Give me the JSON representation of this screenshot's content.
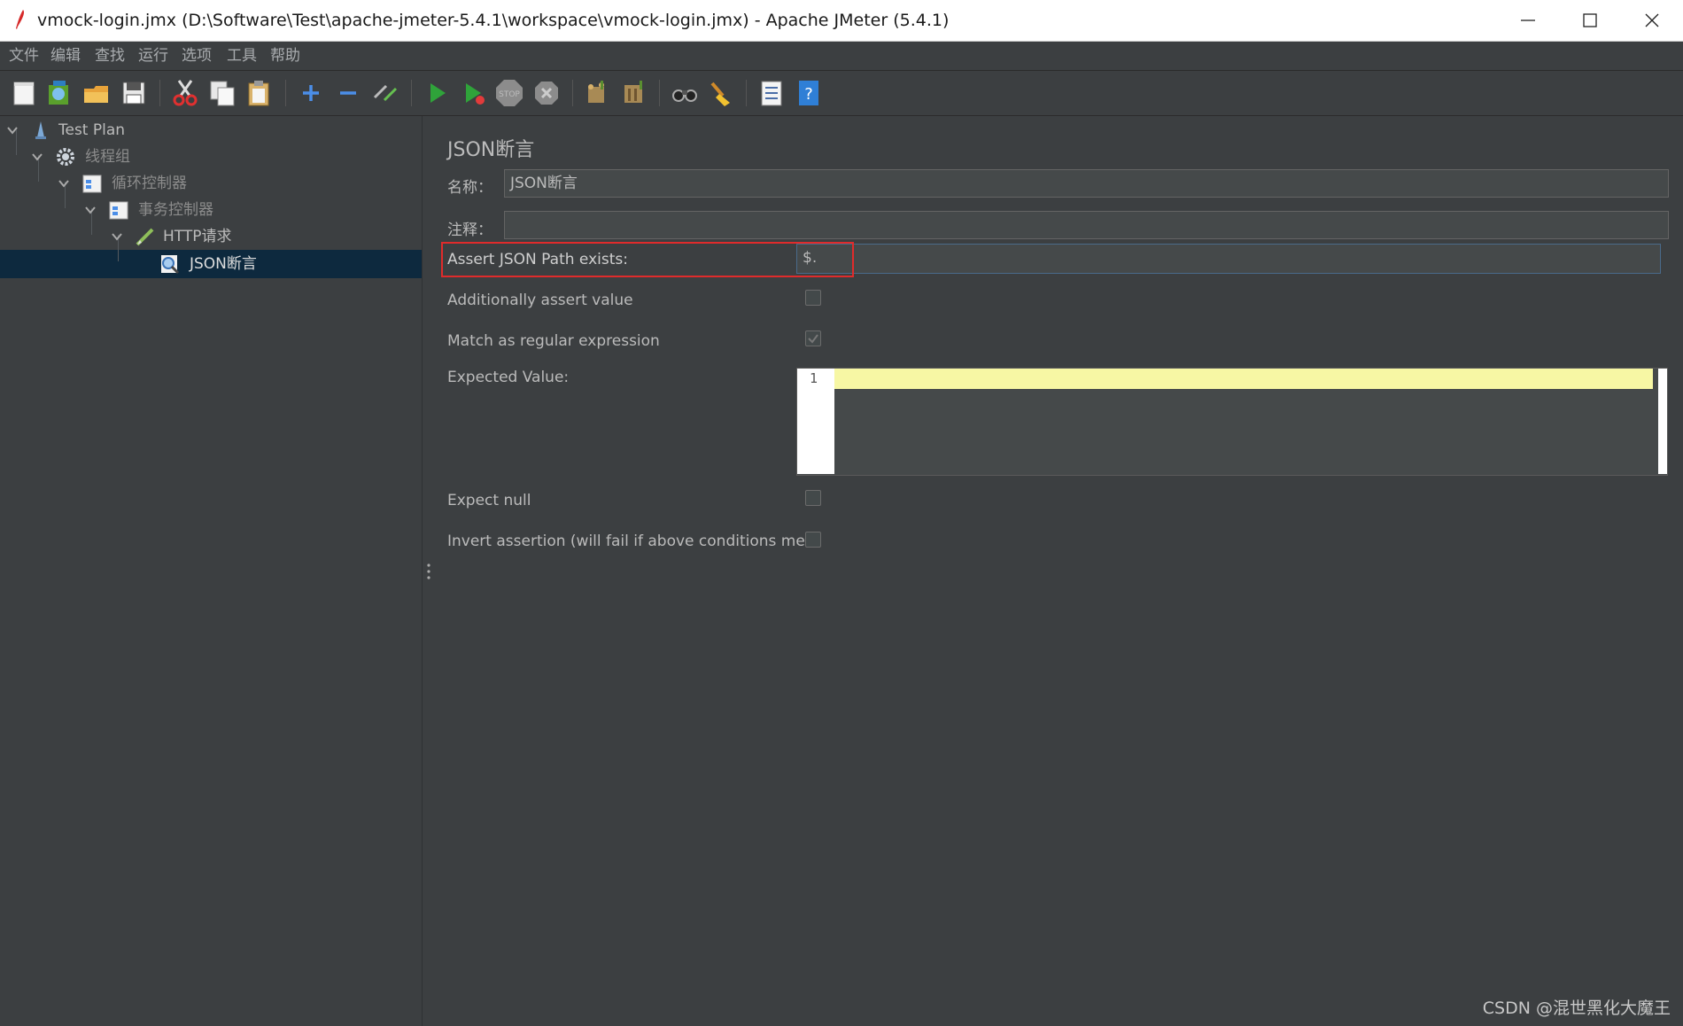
{
  "window": {
    "title": "vmock-login.jmx (D:\\Software\\Test\\apache-jmeter-5.4.1\\workspace\\vmock-login.jmx) - Apache JMeter (5.4.1)"
  },
  "menu": [
    "文件",
    "编辑",
    "查找",
    "运行",
    "选项",
    "工具",
    "帮助"
  ],
  "toolbar_icons": [
    "new-icon",
    "templates-icon",
    "open-icon",
    "save-icon",
    "cut-icon",
    "copy-icon",
    "paste-icon",
    "expand-icon",
    "collapse-icon",
    "toggle-icon",
    "start-icon",
    "start-no-pause-icon",
    "stop-icon",
    "shutdown-icon",
    "clear-icon",
    "clear-all-icon",
    "search-icon",
    "reset-search-icon",
    "function-helper-icon",
    "help-icon"
  ],
  "tree": {
    "nodes": [
      {
        "label": "Test Plan",
        "icon": "test-plan-icon",
        "level": 0
      },
      {
        "label": "线程组",
        "icon": "thread-group-icon",
        "level": 1
      },
      {
        "label": "循环控制器",
        "icon": "loop-controller-icon",
        "level": 2
      },
      {
        "label": "事务控制器",
        "icon": "transaction-controller-icon",
        "level": 3
      },
      {
        "label": "HTTP请求",
        "icon": "http-sampler-icon",
        "level": 4
      },
      {
        "label": "JSON断言",
        "icon": "json-assertion-icon",
        "level": 5,
        "selected": true
      }
    ]
  },
  "panel": {
    "title": "JSON断言",
    "name_label": "名称：",
    "name_value": "JSON断言",
    "comment_label": "注释：",
    "comment_value": "",
    "json_path_label": "Assert JSON Path exists:",
    "json_path_value": "$.",
    "additionally_label": "Additionally assert value",
    "additionally_checked": false,
    "regex_label": "Match as regular expression",
    "regex_checked": true,
    "regex_enabled": false,
    "expected_label": "Expected Value:",
    "expected_line_number": "1",
    "expect_null_label": "Expect null",
    "expect_null_checked": false,
    "invert_label": "Invert assertion (will fail if above conditions met)",
    "invert_checked": false
  },
  "watermark": "CSDN @混世黑化大魔王",
  "colors": {
    "background": "#3c3f41",
    "selection": "#0d293e",
    "highlight_box": "#e02b2b",
    "editor_current_line": "#f7f7a4"
  }
}
